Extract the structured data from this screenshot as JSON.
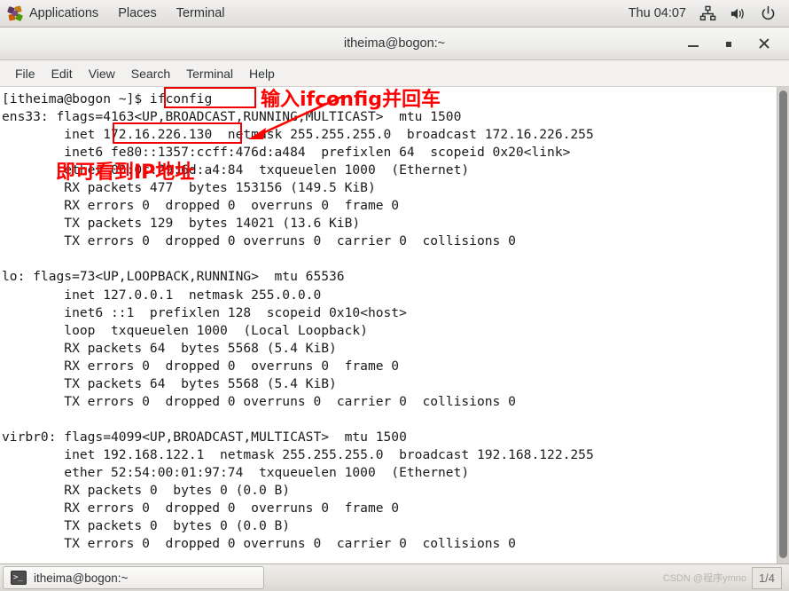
{
  "panel": {
    "applications_label": "Applications",
    "places_label": "Places",
    "terminal_label": "Terminal",
    "clock": "Thu 04:07",
    "network_icon": "network-icon",
    "volume_icon": "volume-icon",
    "power_icon": "power-icon"
  },
  "window": {
    "title": "itheima@bogon:~",
    "minimize_label": "minimize",
    "maximize_label": "maximize",
    "close_label": "close"
  },
  "menu": {
    "items": [
      {
        "label": "File"
      },
      {
        "label": "Edit"
      },
      {
        "label": "View"
      },
      {
        "label": "Search"
      },
      {
        "label": "Terminal"
      },
      {
        "label": "Help"
      }
    ]
  },
  "terminal": {
    "lines": [
      "[itheima@bogon ~]$ ifconfig",
      "ens33: flags=4163<UP,BROADCAST,RUNNING,MULTICAST>  mtu 1500",
      "        inet 172.16.226.130  netmask 255.255.255.0  broadcast 172.16.226.255",
      "        inet6 fe80::1357:ccff:476d:a484  prefixlen 64  scopeid 0x20<link>",
      "        ether 00:0c:29:6d:a4:84  txqueuelen 1000  (Ethernet)",
      "        RX packets 477  bytes 153156 (149.5 KiB)",
      "        RX errors 0  dropped 0  overruns 0  frame 0",
      "        TX packets 129  bytes 14021 (13.6 KiB)",
      "        TX errors 0  dropped 0 overruns 0  carrier 0  collisions 0",
      "",
      "lo: flags=73<UP,LOOPBACK,RUNNING>  mtu 65536",
      "        inet 127.0.0.1  netmask 255.0.0.0",
      "        inet6 ::1  prefixlen 128  scopeid 0x10<host>",
      "        loop  txqueuelen 1000  (Local Loopback)",
      "        RX packets 64  bytes 5568 (5.4 KiB)",
      "        RX errors 0  dropped 0  overruns 0  frame 0",
      "        TX packets 64  bytes 5568 (5.4 KiB)",
      "        TX errors 0  dropped 0 overruns 0  carrier 0  collisions 0",
      "",
      "virbr0: flags=4099<UP,BROADCAST,MULTICAST>  mtu 1500",
      "        inet 192.168.122.1  netmask 255.255.255.0  broadcast 192.168.122.255",
      "        ether 52:54:00:01:97:74  txqueuelen 1000  (Ethernet)",
      "        RX packets 0  bytes 0 (0.0 B)",
      "        RX errors 0  dropped 0  overruns 0  frame 0",
      "        TX packets 0  bytes 0 (0.0 B)",
      "        TX errors 0  dropped 0 overruns 0  carrier 0  collisions 0"
    ]
  },
  "annotations": {
    "color": "#ff0000",
    "command_note": "输入ifconfig并回车",
    "ip_note": "即可看到IP地址",
    "boxed_command": "ifconfig",
    "boxed_ip": "172.16.226.130"
  },
  "taskbar": {
    "task_label": "itheima@bogon:~",
    "watermark": "CSDN @程序ymno",
    "workspace": "1/4"
  }
}
